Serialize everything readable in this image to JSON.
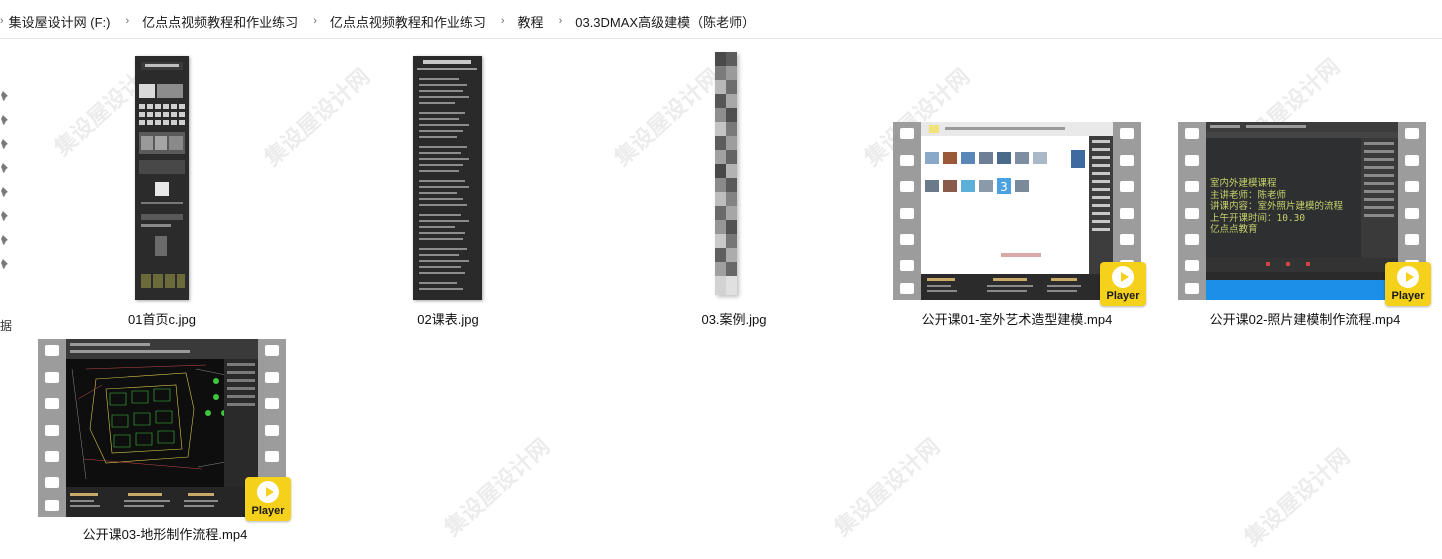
{
  "breadcrumb": {
    "items": [
      "集设屋设计网 (F:)",
      "亿点点视频教程和作业练习",
      "亿点点视频教程和作业练习",
      "教程",
      "03.3DMAX高级建模（陈老师）"
    ]
  },
  "nav": {
    "cut_text": "据"
  },
  "files": [
    {
      "name": "01首页c.jpg",
      "type": "image"
    },
    {
      "name": "02课表.jpg",
      "type": "image"
    },
    {
      "name": "03.案例.jpg",
      "type": "image"
    },
    {
      "name": "公开课01-室外艺术造型建模.mp4",
      "type": "video"
    },
    {
      "name": "公开课02-照片建模制作流程.mp4",
      "type": "video"
    },
    {
      "name": "公开课03-地形制作流程.mp4",
      "type": "video"
    }
  ],
  "badge_label": "Player",
  "video2_text": [
    "室内外建模课程",
    "主讲老师：陈老师",
    "讲课内容：室外照片建模的流程",
    "上午开课时间：10.30",
    "亿点点教育"
  ],
  "colors": {
    "badge": "#f5d11c",
    "film": "#9c9c9c",
    "accent_blue": "#1c8fe8"
  }
}
